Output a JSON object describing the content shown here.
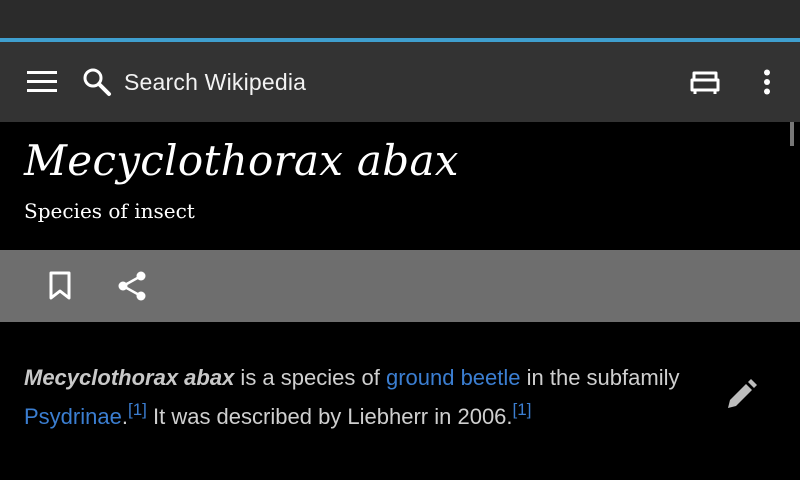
{
  "toolbar": {
    "menu_icon": "menu-icon",
    "search_icon": "search-icon",
    "search_label": "Search Wikipedia",
    "reading_list_icon": "reading-list-icon",
    "overflow_icon": "more-vert-icon"
  },
  "article": {
    "title": "Mecyclothorax abax",
    "subtitle": "Species of insect",
    "actions": {
      "bookmark_icon": "bookmark-icon",
      "share_icon": "share-icon"
    },
    "lead": {
      "bold_term": "Mecyclothorax abax",
      "text1": " is a species of ",
      "link1": "ground beetle",
      "text2": " in the subfamily ",
      "link2": "Psydrinae",
      "text3": ".",
      "ref1": "[1]",
      "text4": " It was described by Liebherr in 2006.",
      "ref2": "[1]"
    },
    "edit_icon": "pencil-icon"
  },
  "colors": {
    "accent": "#3f9fcf",
    "link": "#3b7ed1",
    "toolbar": "#333333",
    "action_bar": "#6e6e6e"
  }
}
